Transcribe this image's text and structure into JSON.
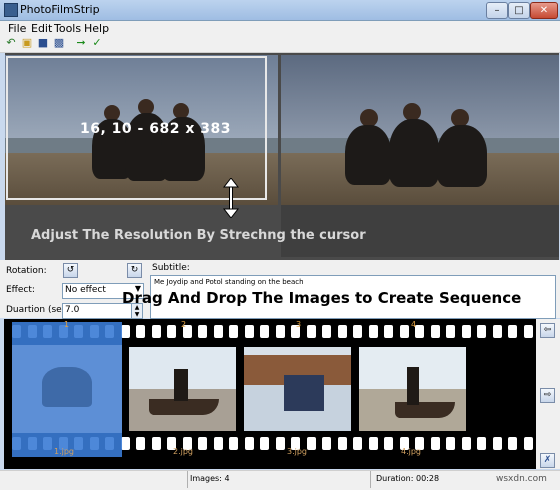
{
  "window": {
    "title": "PhotoFilmStrip"
  },
  "menu": [
    "File",
    "Edit",
    "Tools",
    "Help"
  ],
  "toolbar_icons": [
    "undo-icon",
    "open-icon",
    "save-icon",
    "save-as-icon",
    "import-icon",
    "check-icon"
  ],
  "preview": {
    "resolution": "16, 10 - 682 x 383",
    "hint": "Adjust The Resolution By Strechng the cursor"
  },
  "controls": {
    "rotation_label": "Rotation:",
    "effect_label": "Effect:",
    "effect_value": "No effect",
    "duration_label": "Duartion (sec):",
    "duration_value": "7.0",
    "subtitle_label": "Subtitle:",
    "subtitle_value": "Me Joydip and Potol standing on the beach",
    "overlay": "Drag And Drop The Images to Create Sequence"
  },
  "filmstrip": {
    "frames": [
      {
        "num": "1",
        "name": "1.jpg"
      },
      {
        "num": "2",
        "name": "2.jpg"
      },
      {
        "num": "3",
        "name": "3.jpg"
      },
      {
        "num": "4",
        "name": "4.jpg"
      }
    ]
  },
  "status": {
    "images": "Images: 4",
    "duration": "Duration: 00:28"
  },
  "watermark": "wsxdn.com"
}
